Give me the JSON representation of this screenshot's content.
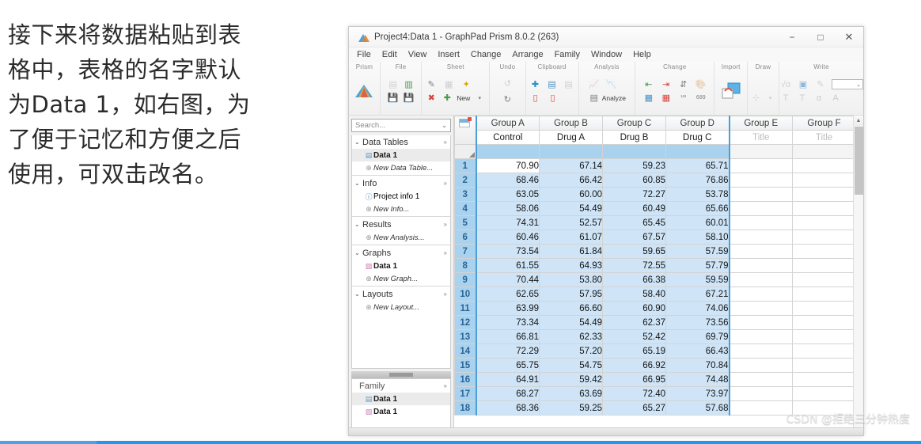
{
  "caption": {
    "text": "接下来将数据粘贴到表\n格中，表格的名字默认\n为Data 1，如右图，为\n了便于记忆和方便之后\n使用，可双击改名。"
  },
  "window": {
    "title": "Project4:Data 1 - GraphPad Prism 8.0.2 (263)",
    "app_icon": "prism-logo-icon",
    "controls": {
      "minimize": "−",
      "maximize": "□",
      "close": "✕"
    },
    "menus": [
      "File",
      "Edit",
      "View",
      "Insert",
      "Change",
      "Arrange",
      "Family",
      "Window",
      "Help"
    ],
    "ribbon_groups": [
      {
        "label": "Prism",
        "icons": [
          "prism-logo-icon"
        ]
      },
      {
        "label": "File",
        "icons": [
          "new-file-icon",
          "open-file-icon",
          "save-icon",
          "save-as-icon"
        ]
      },
      {
        "label": "Sheet",
        "icons": [
          "edit-sheet-icon",
          "duplicate-sheet-icon",
          "pin-sheet-icon",
          "delete-sheet-icon",
          "new-sheet-icon"
        ],
        "new_label": "New"
      },
      {
        "label": "Undo",
        "icons": [
          "undo-icon",
          "redo-icon"
        ]
      },
      {
        "label": "Clipboard",
        "icons": [
          "paste-icon",
          "copy-icon",
          "copy-special-icon",
          "cut-icon",
          "clipboard-icon"
        ]
      },
      {
        "label": "Analysis",
        "icons": [
          "analyze-chart-icon",
          "analyze-chart2-icon",
          "analyze-icon"
        ],
        "analyze_label": "Analyze"
      },
      {
        "label": "Change",
        "icons": [
          "insert-left-icon",
          "insert-right-icon",
          "sort-icon",
          "fill-color-icon",
          "swap-icon",
          "transform-icon",
          "decimals-icon",
          "remove-icon"
        ]
      },
      {
        "label": "Import",
        "icons": [
          "import-data-icon"
        ]
      },
      {
        "label": "Draw",
        "icons": [
          "draw-shape-icon"
        ]
      },
      {
        "label": "Write",
        "icons": [
          "equation-icon",
          "textbox-icon",
          "brush-icon",
          "font-size-combo",
          "text-icon",
          "text2-icon",
          "alpha-icon",
          "font-a-icon"
        ]
      }
    ]
  },
  "navigator": {
    "search": {
      "placeholder": "Search...",
      "value": "",
      "chevron": "⌄"
    },
    "sections": [
      {
        "title": "Data Tables",
        "items": [
          {
            "label": "Data 1",
            "icon": "data-table-icon",
            "style": "bold",
            "selected": true
          },
          {
            "label": "New Data Table...",
            "icon": "plus-circle-icon",
            "style": "italic",
            "selected": false
          }
        ]
      },
      {
        "title": "Info",
        "items": [
          {
            "label": "Project info 1",
            "icon": "info-circle-icon",
            "style": "normal",
            "selected": false
          },
          {
            "label": "New Info...",
            "icon": "plus-circle-icon",
            "style": "italic",
            "selected": false
          }
        ]
      },
      {
        "title": "Results",
        "items": [
          {
            "label": "New Analysis...",
            "icon": "plus-circle-icon",
            "style": "italic",
            "selected": false
          }
        ]
      },
      {
        "title": "Graphs",
        "items": [
          {
            "label": "Data 1",
            "icon": "graph-icon",
            "style": "bold",
            "selected": false
          },
          {
            "label": "New Graph...",
            "icon": "plus-circle-icon",
            "style": "italic",
            "selected": false
          }
        ]
      },
      {
        "title": "Layouts",
        "items": [
          {
            "label": "New Layout...",
            "icon": "plus-circle-icon",
            "style": "italic",
            "selected": false
          }
        ]
      }
    ],
    "family": {
      "title": "Family",
      "items": [
        {
          "label": "Data 1",
          "icon": "data-table-icon",
          "selected": true
        },
        {
          "label": "Data 1",
          "icon": "graph-icon",
          "selected": false
        }
      ]
    }
  },
  "table": {
    "columns": [
      {
        "group": "Group A",
        "title": "Control",
        "placeholder": false
      },
      {
        "group": "Group B",
        "title": "Drug A",
        "placeholder": false
      },
      {
        "group": "Group C",
        "title": "Drug B",
        "placeholder": false
      },
      {
        "group": "Group D",
        "title": "Drug C",
        "placeholder": false
      },
      {
        "group": "Group E",
        "title": "Title",
        "placeholder": true
      },
      {
        "group": "Group F",
        "title": "Title",
        "placeholder": true
      }
    ],
    "row_numbers": [
      1,
      2,
      3,
      4,
      5,
      6,
      7,
      8,
      9,
      10,
      11,
      12,
      13,
      14,
      15,
      16,
      17,
      18
    ],
    "rows": [
      [
        "70.90",
        "67.14",
        "59.23",
        "65.71",
        "",
        ""
      ],
      [
        "68.46",
        "66.42",
        "60.85",
        "76.86",
        "",
        ""
      ],
      [
        "63.05",
        "60.00",
        "72.27",
        "53.78",
        "",
        ""
      ],
      [
        "58.06",
        "54.49",
        "60.49",
        "65.66",
        "",
        ""
      ],
      [
        "74.31",
        "52.57",
        "65.45",
        "60.01",
        "",
        ""
      ],
      [
        "60.46",
        "61.07",
        "67.57",
        "58.10",
        "",
        ""
      ],
      [
        "73.54",
        "61.84",
        "59.65",
        "57.59",
        "",
        ""
      ],
      [
        "61.55",
        "64.93",
        "72.55",
        "57.79",
        "",
        ""
      ],
      [
        "70.44",
        "53.80",
        "66.38",
        "59.59",
        "",
        ""
      ],
      [
        "62.65",
        "57.95",
        "58.40",
        "67.21",
        "",
        ""
      ],
      [
        "63.99",
        "66.60",
        "60.90",
        "74.06",
        "",
        ""
      ],
      [
        "73.34",
        "54.49",
        "62.37",
        "73.56",
        "",
        ""
      ],
      [
        "66.81",
        "62.33",
        "52.42",
        "69.79",
        "",
        ""
      ],
      [
        "72.29",
        "57.20",
        "65.19",
        "66.43",
        "",
        ""
      ],
      [
        "65.75",
        "54.75",
        "66.92",
        "70.84",
        "",
        ""
      ],
      [
        "64.91",
        "59.42",
        "66.95",
        "74.48",
        "",
        ""
      ],
      [
        "68.27",
        "63.69",
        "72.40",
        "73.97",
        "",
        ""
      ],
      [
        "68.36",
        "59.25",
        "65.27",
        "57.68",
        "",
        ""
      ]
    ],
    "active_cell": {
      "row": 1,
      "col": 1
    },
    "selected_columns": [
      1,
      2,
      3,
      4
    ],
    "scrollbar": {
      "up_arrow": "▲",
      "position": "top"
    }
  },
  "watermark": {
    "text": "CSDN @拒绝三分钟热度"
  },
  "colors": {
    "selection_header": "#a9d2ef",
    "selection_cell": "#cfe5f7",
    "selection_border": "#4b9fd8",
    "row_number_text": "#2a6496",
    "accent_blue": "#2196f3"
  }
}
